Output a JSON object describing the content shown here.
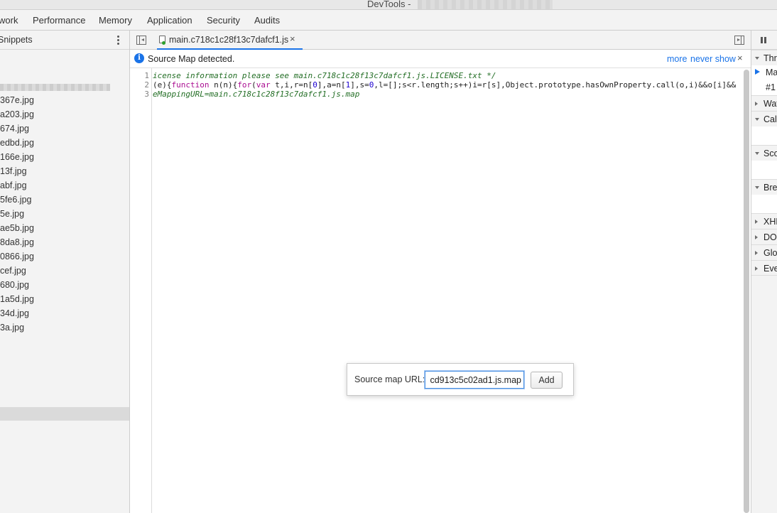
{
  "window": {
    "title": "DevTools -"
  },
  "main_tabs": [
    {
      "label": "work"
    },
    {
      "label": "Performance"
    },
    {
      "label": "Memory"
    },
    {
      "label": "Application"
    },
    {
      "label": "Security"
    },
    {
      "label": "Audits"
    }
  ],
  "navigator": {
    "header_label": "Snippets",
    "files": [
      "367e.jpg",
      "a203.jpg",
      "674.jpg",
      "edbd.jpg",
      "166e.jpg",
      "13f.jpg",
      "abf.jpg",
      "5fe6.jpg",
      "5e.jpg",
      "ae5b.jpg",
      "8da8.jpg",
      "0866.jpg",
      "cef.jpg",
      "680.jpg",
      "1a5d.jpg",
      "34d.jpg",
      "3a.jpg"
    ]
  },
  "editor_tab": {
    "filename": "main.c718c1c28f13c7dafcf1.js",
    "close": "×"
  },
  "infobar": {
    "icon": "info-icon",
    "message": "Source Map detected.",
    "more": "more",
    "never_show": "never show",
    "close": "×"
  },
  "code": {
    "line_numbers": [
      "1",
      "2",
      "3"
    ],
    "line1": "icense information please see main.c718c1c28f13c7dafcf1.js.LICENSE.txt */",
    "line2": {
      "p1": "(e){",
      "kw1": "function",
      "p2": " n(n){",
      "kw2": "for",
      "p3": "(",
      "kw3": "var",
      "p4": " t,i,r=n[",
      "n1": "0",
      "p5": "],a=n[",
      "n2": "1",
      "p6": "],s=",
      "n3": "0",
      "p7": ",l=[];s<r.length;s++)i=r[s],Object.prototype.hasOwnProperty.call(o,i)&&o[i]&&"
    },
    "line3": "eMappingURL=main.c718c1c28f13c7dafcf1.js.map"
  },
  "source_map_dialog": {
    "label": "Source map URL:",
    "input_value": "cd913c5c02ad1.js.map",
    "add_button": "Add"
  },
  "debugger": {
    "pause_icon": "pause-icon",
    "panes": {
      "threads": "Thre",
      "thread_main": "Ma",
      "thread_1": "#1",
      "watch": "Wat",
      "call_stack": "Call",
      "scope": "Sco",
      "breakpoints": "Bre",
      "xhr": "XHR",
      "dom": "DOM",
      "global": "Glo",
      "event": "Eve"
    }
  }
}
